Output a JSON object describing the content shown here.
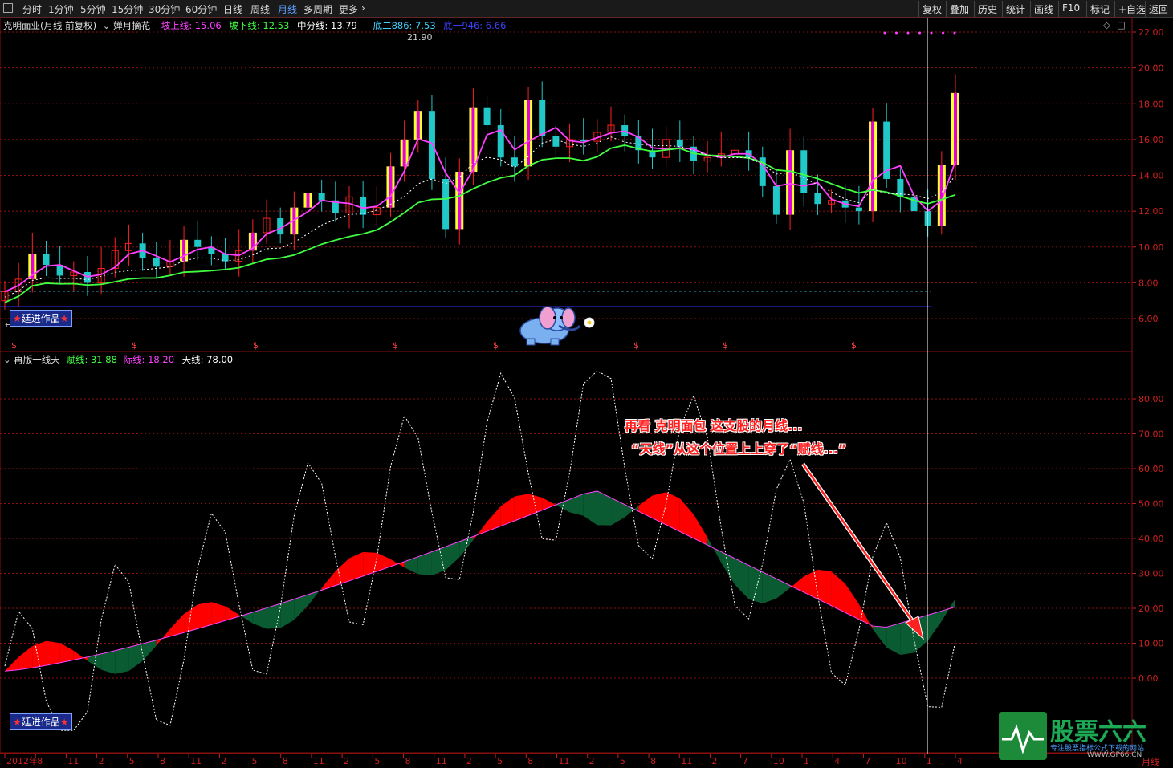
{
  "toolbar": {
    "periods": [
      "分时",
      "1分钟",
      "5分钟",
      "15分钟",
      "30分钟",
      "60分钟",
      "日线",
      "周线",
      "月线",
      "多周期",
      "更多"
    ],
    "active": "月线",
    "buttons": [
      "复权",
      "叠加",
      "历史",
      "统计",
      "画线",
      "F10",
      "标记",
      "+自选",
      "返回"
    ]
  },
  "main_panel": {
    "stock_title": "克明面业(月线 前复权)",
    "indicator_name": "婵月摘花",
    "legend": [
      {
        "label": "坡上线: 15.06",
        "color": "#ff40ff"
      },
      {
        "label": "坡下线: 12.53",
        "color": "#40ff40"
      },
      {
        "label": "中分线: 13.79",
        "color": "#ffffff"
      },
      {
        "label": "底二886: 7.53",
        "color": "#40d0ff"
      },
      {
        "label": "底一946: 6.66",
        "color": "#4040ff"
      }
    ],
    "high_label": "21.90",
    "low_label": "5.88",
    "y_ticks": [
      "22.00",
      "20.00",
      "18.00",
      "16.00",
      "14.00",
      "12.00",
      "10.00",
      "8.00",
      "6.00"
    ],
    "badge": "廷进作品"
  },
  "sub_panel": {
    "indicator_name": "再版一线天",
    "legend": [
      {
        "label": "赋线: 31.88",
        "color": "#40ff40"
      },
      {
        "label": "际线: 18.20",
        "color": "#ff40ff"
      },
      {
        "label": "天线: 78.00",
        "color": "#ffffff"
      }
    ],
    "y_ticks": [
      "80.00",
      "70.00",
      "60.00",
      "50.00",
      "40.00",
      "30.00",
      "20.00",
      "10.00",
      "0.00"
    ],
    "badge": "廷进作品",
    "annotation_line1": "再看 克明面包 这支股的月线...",
    "annotation_line2": "“天线”从这个位置上上穿了“赋线...”"
  },
  "x_axis": {
    "labels": [
      "2012年",
      "8",
      "11",
      "2",
      "5",
      "8",
      "11",
      "2",
      "5",
      "8",
      "11",
      "2",
      "5",
      "8",
      "11",
      "2",
      "5",
      "8",
      "11",
      "2",
      "5",
      "8",
      "11",
      "2",
      "7",
      "10",
      "1",
      "4",
      "7",
      "10",
      "1",
      "4"
    ],
    "period_label": "月线"
  },
  "logo": {
    "name": "股票六六",
    "slogan": "专注股票指标公式下载的网站",
    "url": "WWW.GP66.CN"
  },
  "colors": {
    "up": "#ff2020",
    "down": "#20c8c8",
    "fill_up": "#ff0000",
    "fill_down": "#0a5a32",
    "grid": "#8a1010",
    "cursor": "#ffffff"
  }
}
